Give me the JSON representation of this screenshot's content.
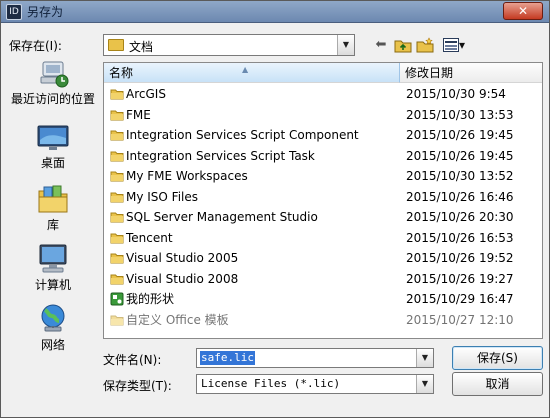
{
  "window": {
    "title": "另存为",
    "app_icon_glyph": "ID",
    "close_glyph": "✕"
  },
  "save_in": {
    "label": "保存在(I):",
    "value": "文档"
  },
  "toolbar": {
    "back_glyph": "⬅",
    "view_menu_glyph": "▾"
  },
  "places": [
    {
      "label": "最近访问的位置",
      "icon": "recent-places-icon"
    },
    {
      "label": "桌面",
      "icon": "desktop-icon"
    },
    {
      "label": "库",
      "icon": "libraries-icon"
    },
    {
      "label": "计算机",
      "icon": "computer-icon"
    },
    {
      "label": "网络",
      "icon": "network-icon"
    }
  ],
  "columns": {
    "name": "名称",
    "date": "修改日期"
  },
  "files": [
    {
      "name": "ArcGIS",
      "date": "2015/10/30 9:54",
      "type": "folder"
    },
    {
      "name": "FME",
      "date": "2015/10/30 13:53",
      "type": "folder"
    },
    {
      "name": "Integration Services Script Component",
      "date": "2015/10/26 19:45",
      "type": "folder"
    },
    {
      "name": "Integration Services Script Task",
      "date": "2015/10/26 19:45",
      "type": "folder"
    },
    {
      "name": "My FME Workspaces",
      "date": "2015/10/30 13:52",
      "type": "folder"
    },
    {
      "name": "My ISO Files",
      "date": "2015/10/26 16:46",
      "type": "folder"
    },
    {
      "name": "SQL Server Management Studio",
      "date": "2015/10/26 20:30",
      "type": "folder"
    },
    {
      "name": "Tencent",
      "date": "2015/10/26 16:53",
      "type": "folder"
    },
    {
      "name": "Visual Studio 2005",
      "date": "2015/10/26 19:52",
      "type": "folder"
    },
    {
      "name": "Visual Studio 2008",
      "date": "2015/10/26 19:27",
      "type": "folder"
    },
    {
      "name": "我的形状",
      "date": "2015/10/29 16:47",
      "type": "shapes"
    },
    {
      "name": "自定义 Office 模板",
      "date": "2015/10/27 12:10",
      "type": "folder"
    }
  ],
  "filename": {
    "label": "文件名(N):",
    "value": "safe.lic"
  },
  "filetype": {
    "label": "保存类型(T):",
    "value": "License Files (*.lic)"
  },
  "buttons": {
    "save": "保存(S)",
    "cancel": "取消"
  },
  "colors": {
    "selection": "#3375d7",
    "folder": "#e9c24a",
    "header_active": "#c8e2f7"
  }
}
